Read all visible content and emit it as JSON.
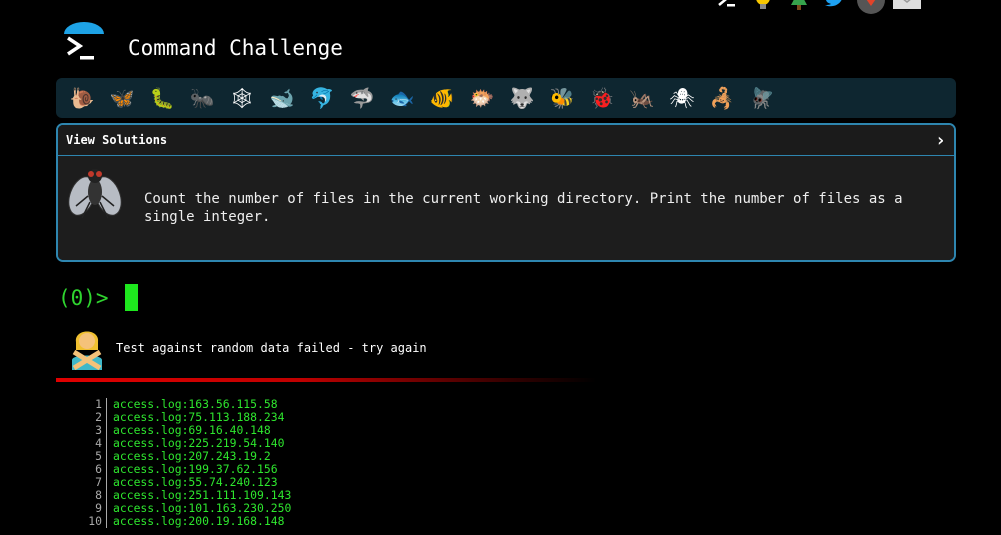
{
  "header": {
    "title": "Command Challenge",
    "top_icons": [
      "terminal-icon",
      "bulb-icon",
      "tree-icon",
      "twitter-icon",
      "gitlab-icon",
      "mail-icon"
    ]
  },
  "levels": [
    {
      "name": "snail",
      "glyph": "🐌"
    },
    {
      "name": "butterfly",
      "glyph": "🦋"
    },
    {
      "name": "caterpillar",
      "glyph": "🐛"
    },
    {
      "name": "ant",
      "glyph": "🐜"
    },
    {
      "name": "spider-web",
      "glyph": "🕸"
    },
    {
      "name": "whale",
      "glyph": "🐋"
    },
    {
      "name": "dolphin",
      "glyph": "🐬"
    },
    {
      "name": "shark",
      "glyph": "🦈"
    },
    {
      "name": "fish",
      "glyph": "🐟"
    },
    {
      "name": "tropical-fish",
      "glyph": "🐠"
    },
    {
      "name": "blowfish",
      "glyph": "🐡"
    },
    {
      "name": "wolf",
      "glyph": "🐺"
    },
    {
      "name": "bee",
      "glyph": "🐝"
    },
    {
      "name": "ladybug",
      "glyph": "🐞"
    },
    {
      "name": "cricket",
      "glyph": "🦗"
    },
    {
      "name": "spider",
      "glyph": "🕷"
    },
    {
      "name": "scorpion",
      "glyph": "🦂"
    },
    {
      "name": "fly",
      "glyph": "🪰"
    }
  ],
  "challenge": {
    "header_label": "View Solutions",
    "chevron": "›",
    "description": "Count the number of files in the current working directory. Print the number of files as a single integer."
  },
  "prompt": {
    "text": "(0)>"
  },
  "result": {
    "message": "Test against random data failed - try again"
  },
  "output": {
    "lines": [
      {
        "n": "1",
        "text": "access.log:163.56.115.58"
      },
      {
        "n": "2",
        "text": "access.log:75.113.188.234"
      },
      {
        "n": "3",
        "text": "access.log:69.16.40.148"
      },
      {
        "n": "4",
        "text": "access.log:225.219.54.140"
      },
      {
        "n": "5",
        "text": "access.log:207.243.19.2"
      },
      {
        "n": "6",
        "text": "access.log:199.37.62.156"
      },
      {
        "n": "7",
        "text": "access.log:55.74.240.123"
      },
      {
        "n": "8",
        "text": "access.log:251.111.109.143"
      },
      {
        "n": "9",
        "text": "access.log:101.163.230.250"
      },
      {
        "n": "10",
        "text": "access.log:200.19.168.148"
      }
    ]
  },
  "colors": {
    "accent": "#2e86b0",
    "prompt_green": "#2fd42f",
    "cursor_green": "#1ee81e",
    "error_red": "#e00000",
    "level_bar_bg": "#0e2630"
  }
}
